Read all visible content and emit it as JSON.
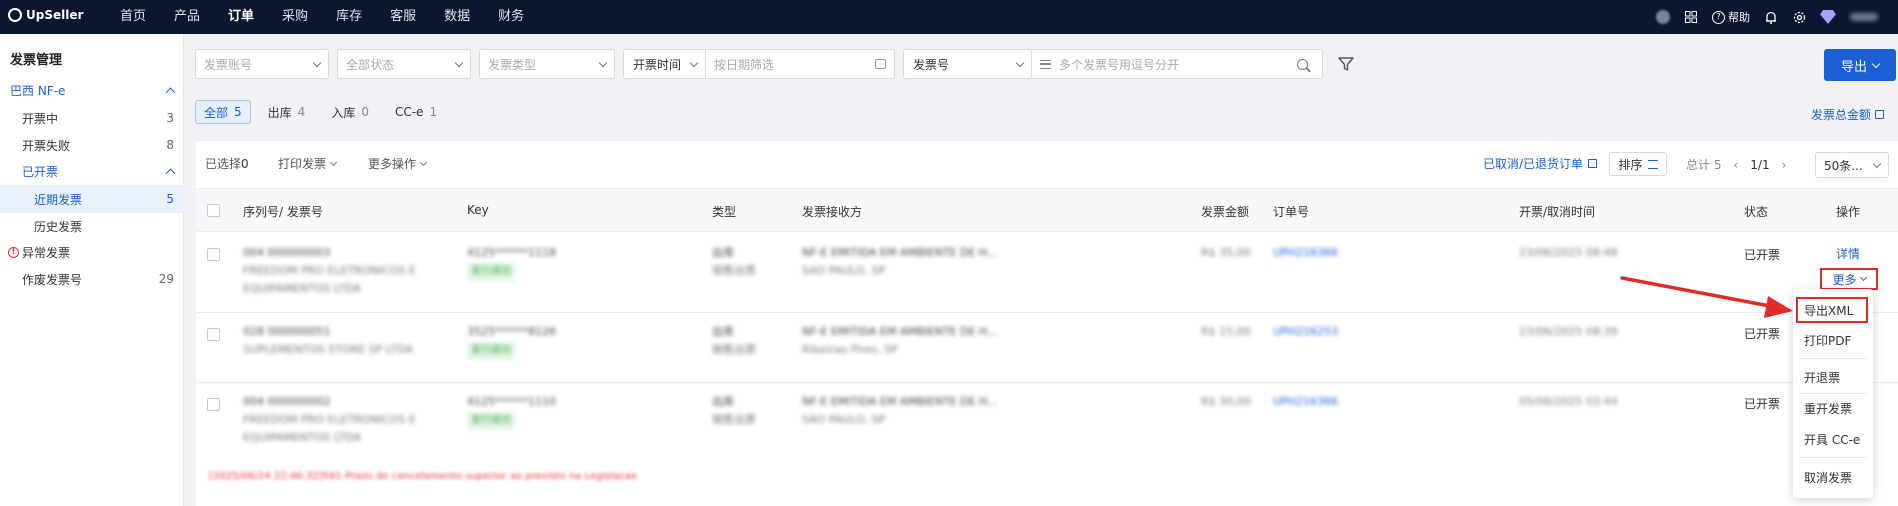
{
  "topbar": {
    "brand": "UpSeller",
    "nav": [
      "首页",
      "产品",
      "订单",
      "采购",
      "库存",
      "客服",
      "数据",
      "财务"
    ],
    "active_nav": "订单",
    "help_label": "帮助"
  },
  "sidebar": {
    "title": "发票管理",
    "group_nfe": "巴西 NF-e",
    "invoicing": {
      "label": "开票中",
      "count": "3"
    },
    "failed": {
      "label": "开票失败",
      "count": "8"
    },
    "group_issued": "已开票",
    "recent": {
      "label": "近期发票",
      "count": "5"
    },
    "history": {
      "label": "历史发票"
    },
    "abnormal": {
      "label": "异常发票"
    },
    "voided": {
      "label": "作废发票号",
      "count": "29"
    }
  },
  "filters": {
    "account_placeholder": "发票账号",
    "status_placeholder": "全部状态",
    "type_placeholder": "发票类型",
    "time_select": "开票时间",
    "date_placeholder": "按日期筛选",
    "number_select": "发票号",
    "number_placeholder": "多个发票号用逗号分开",
    "export_label": "导出"
  },
  "tabs": [
    {
      "label": "全部",
      "count": "5"
    },
    {
      "label": "出库",
      "count": "4"
    },
    {
      "label": "入库",
      "count": "0"
    },
    {
      "label": "CC-e",
      "count": "1"
    }
  ],
  "total_amount_link": "发票总金额",
  "toolbar": {
    "selected_label": "已选择",
    "selected_count": "0",
    "print_label": "打印发票",
    "more_ops_label": "更多操作",
    "cancelled_link": "已取消/已退货订单",
    "sort_label": "排序",
    "total_label": "总计 5",
    "page_indicator": "1/1",
    "page_size": "50条..."
  },
  "table": {
    "columns": [
      "序列号/ 发票号",
      "Key",
      "类型",
      "发票接收方",
      "发票金额",
      "订单号",
      "开票/取消时间",
      "状态",
      "操作"
    ],
    "rows": [
      {
        "serial": "004 000000003",
        "company": "FREEDOM PRO ELETRONICOS E EQUIPAMENTOS LTDA",
        "key": "4125******1118",
        "key_tag": "发行成功",
        "type": "出库",
        "type_sub": "销售出票",
        "receiver": "NF-E EMITIDA EM AMBIENTE DE H...",
        "receiver_loc": "SAO PAULO, SP",
        "amount": "R$ 35,00",
        "order": "UPH216366",
        "time": "23/06/2025 08:48",
        "status": "已开票",
        "op_detail": "详情",
        "op_more": "更多"
      },
      {
        "serial": "028 000000051",
        "company": "SUPLEMENTOS STORE SP LTDA",
        "key": "3525******8126",
        "key_tag": "发行成功",
        "type": "出库",
        "type_sub": "销售出票",
        "receiver": "NF-E EMITIDA EM AMBIENTE DE H...",
        "receiver_loc": "Ribeirao Pires, SP",
        "amount": "R$ 15,00",
        "order": "UPH216253",
        "time": "23/06/2025 08:39",
        "status": "已开票"
      },
      {
        "serial": "004 000000002",
        "company": "FREEDOM PRO ELETRONICOS E EQUIPAMENTOS LTDA",
        "key": "4125******1110",
        "key_tag": "发行成功",
        "type": "出库",
        "type_sub": "销售出票",
        "receiver": "NF-E EMITIDA EM AMBIENTE DE H...",
        "receiver_loc": "SAO PAULO, SP",
        "amount": "R$ 30,00",
        "order": "UPH216366",
        "time": "05/06/2025 03:44",
        "status": "已开票"
      }
    ],
    "error_line": "[2025/06/24 22:46:32]591-Prazo de cancelamento superior ao previsto na Legislacao"
  },
  "dropdown": {
    "items": [
      "导出XML",
      "打印PDF",
      "开退票",
      "重开发票",
      "开具 CC-e",
      "取消发票"
    ]
  },
  "colors": {
    "topbar": "#0b1631",
    "accent": "#1a5fd4",
    "highlight_red": "#e12b2b"
  }
}
